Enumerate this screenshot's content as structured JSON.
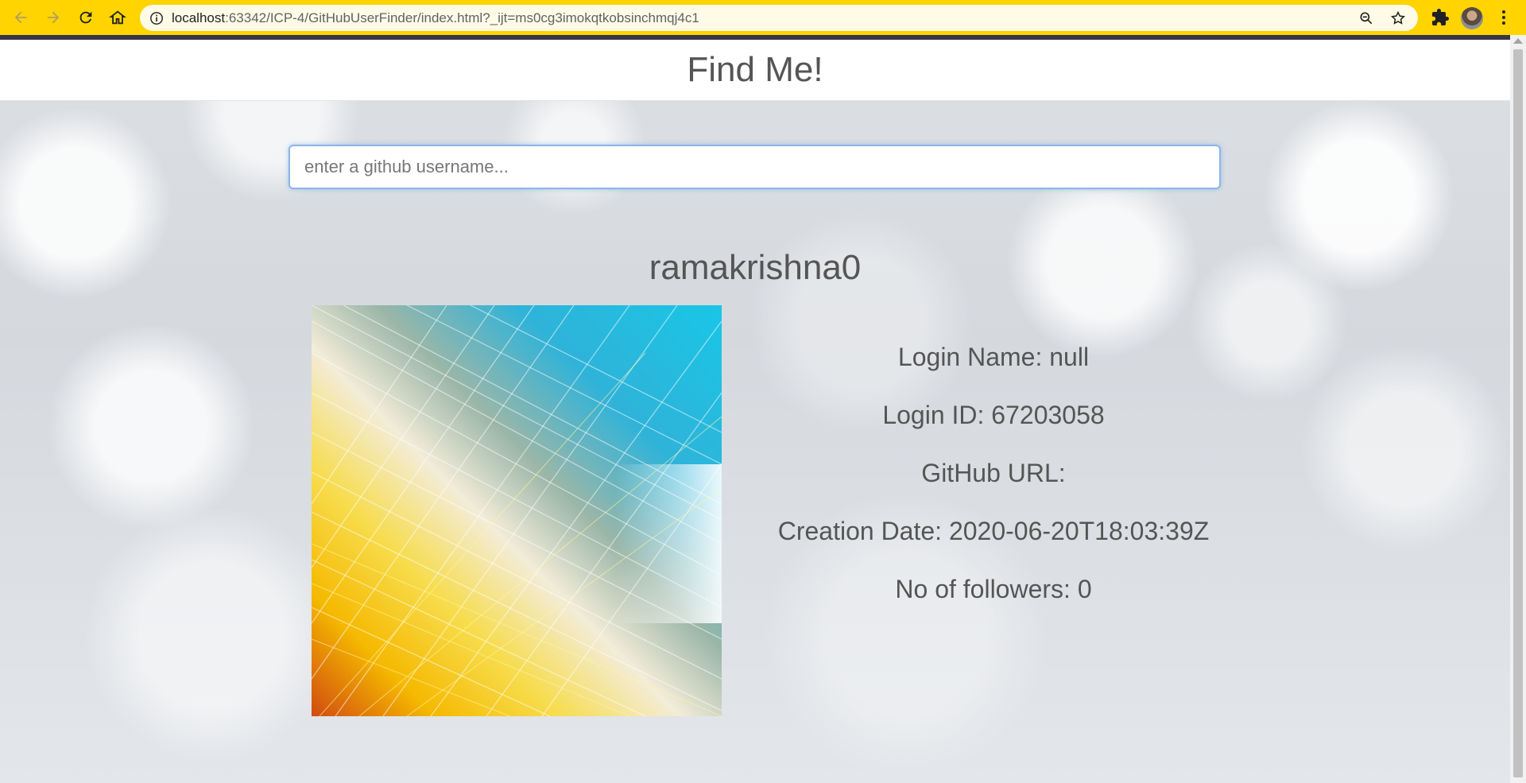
{
  "browser": {
    "url_host": "localhost",
    "url_rest": ":63342/ICP-4/GitHubUserFinder/index.html?_ijt=ms0cg3imokqtkobsinchmqj4c1",
    "icons": [
      "back-icon",
      "forward-icon",
      "reload-icon",
      "home-icon",
      "info-icon",
      "zoom-icon",
      "star-icon",
      "extensions-icon",
      "profile-avatar",
      "menu-icon"
    ]
  },
  "header": {
    "title": "Find Me!"
  },
  "search": {
    "placeholder": "enter a github username..."
  },
  "user": {
    "username": "ramakrishna0",
    "login_name": "Login Name: null",
    "login_id": "Login ID: 67203058",
    "github_url": "GitHub URL:",
    "creation_date": "Creation Date: 2020-06-20T18:03:39Z",
    "followers": "No of followers: 0"
  },
  "colors": {
    "chrome": "#ffd400",
    "text": "#555555",
    "search_focus": "#8fb4e6"
  }
}
